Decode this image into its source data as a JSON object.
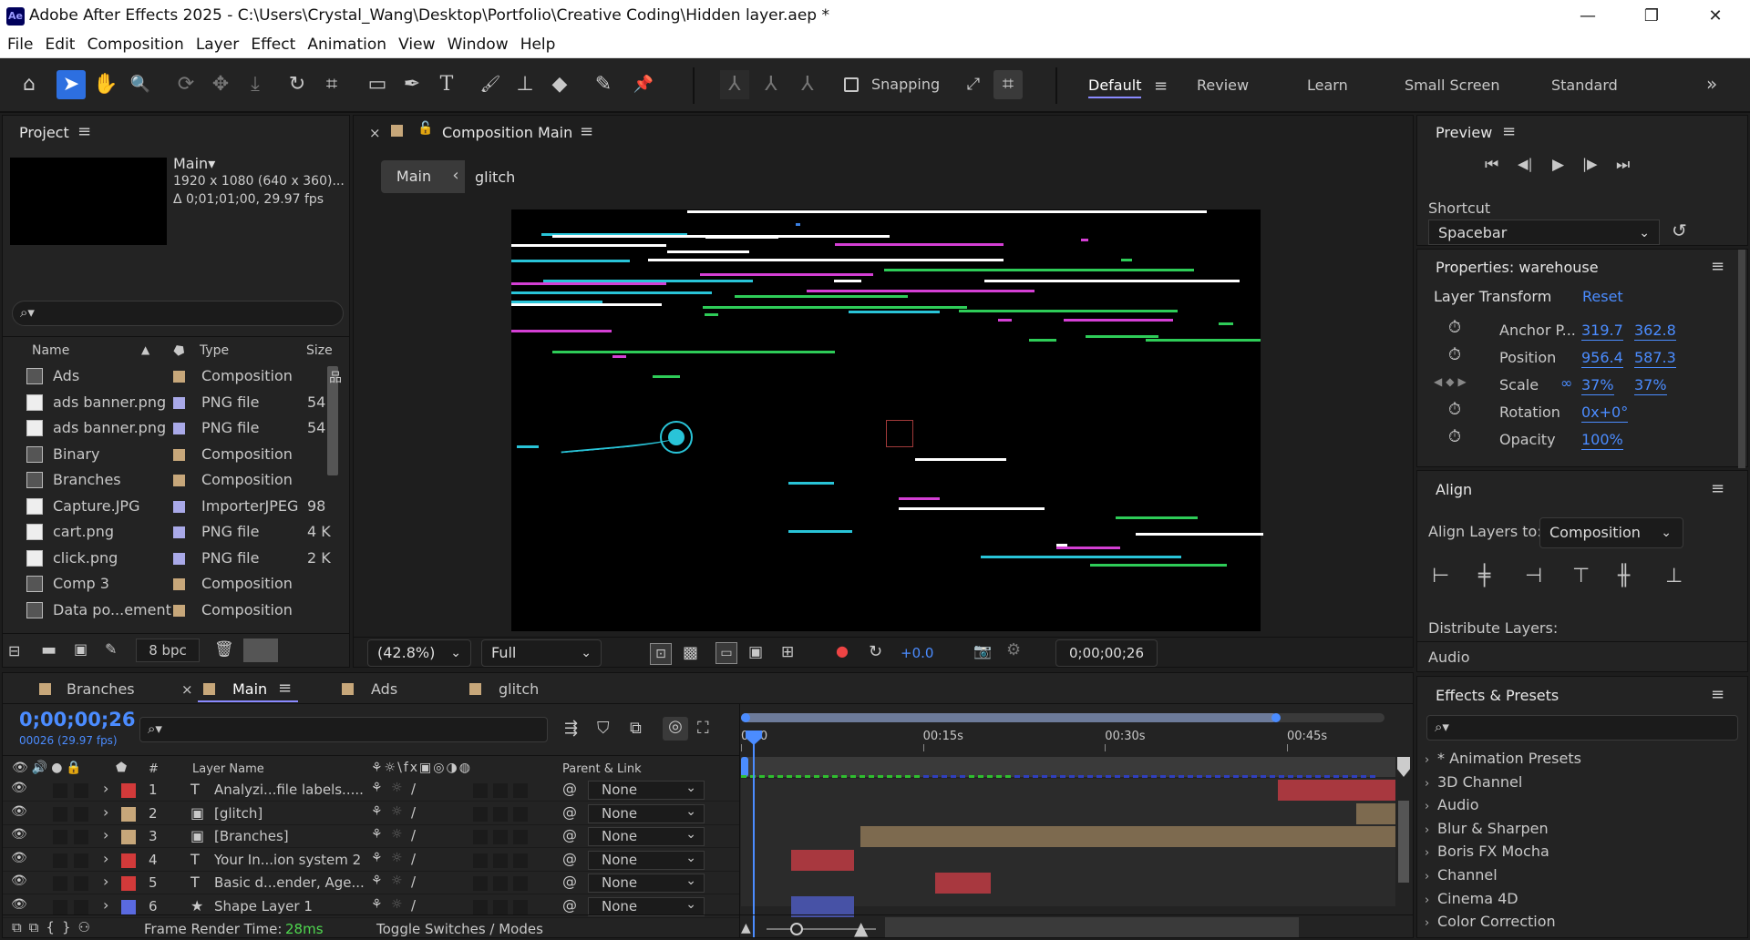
{
  "app": {
    "badge": "Ae",
    "title": "Adobe After Effects 2025 - C:\\Users\\Crystal_Wang\\Desktop\\Portfolio\\Creative Coding\\Hidden layer.aep *",
    "minimize": "—",
    "maximize": "❐",
    "close": "✕"
  },
  "menu": [
    "File",
    "Edit",
    "Composition",
    "Layer",
    "Effect",
    "Animation",
    "View",
    "Window",
    "Help"
  ],
  "toolbar": {
    "snapping_label": "Snapping",
    "workspaces": [
      "Default",
      "Review",
      "Learn",
      "Small Screen",
      "Standard"
    ],
    "more": "»",
    "tools": {
      "home": "⌂",
      "select": "➤",
      "hand": "✋",
      "zoom": "🔍",
      "orbit": "⟳",
      "pan": "✥",
      "dolly": "⤓",
      "rotate": "↻",
      "anchor": "⌗",
      "rect": "▭",
      "pen": "✒",
      "text": "T",
      "brush": "🖌",
      "stamp": "⊥",
      "eraser": "◆",
      "roto": "✎",
      "puppet": "📌",
      "axis1": "⅄",
      "axis2": "⅄",
      "axis3": "⅄",
      "snap2": "⤢",
      "snap3": "⌗"
    }
  },
  "project": {
    "title": "Project",
    "menu_glyph": "≡",
    "comp_name": "Main▾",
    "comp_res": "1920 x 1080  (640 x 360)...",
    "comp_dur": "Δ 0;01;01;00, 29.97 fps",
    "search_icon": "⌕▾",
    "columns": {
      "name": "Name",
      "sort": "▲",
      "type": "Type",
      "size": "Size"
    },
    "items": [
      {
        "name": "Ads",
        "type": "Composition",
        "size": "",
        "color": "#c7a77a",
        "icon": "comp"
      },
      {
        "name": "ads banner.png",
        "type": "PNG file",
        "size": "54",
        "color": "#a9a9e8",
        "icon": "file"
      },
      {
        "name": "ads banner.png",
        "type": "PNG file",
        "size": "54",
        "color": "#a9a9e8",
        "icon": "file"
      },
      {
        "name": "Binary",
        "type": "Composition",
        "size": "",
        "color": "#c7a77a",
        "icon": "comp"
      },
      {
        "name": "Branches",
        "type": "Composition",
        "size": "",
        "color": "#c7a77a",
        "icon": "comp"
      },
      {
        "name": "Capture.JPG",
        "type": "ImporterJPEG",
        "size": "98",
        "color": "#a9a9e8",
        "icon": "file"
      },
      {
        "name": "cart.png",
        "type": "PNG file",
        "size": "4 K",
        "color": "#a9a9e8",
        "icon": "file"
      },
      {
        "name": "click.png",
        "type": "PNG file",
        "size": "2 K",
        "color": "#a9a9e8",
        "icon": "file"
      },
      {
        "name": "Comp 3",
        "type": "Composition",
        "size": "",
        "color": "#c7a77a",
        "icon": "comp"
      },
      {
        "name": "Data po...ement",
        "type": "Composition",
        "size": "",
        "color": "#c7a77a",
        "icon": "comp"
      }
    ],
    "bpc": "8 bpc",
    "trash": "🗑"
  },
  "composition": {
    "close": "×",
    "lock": "🔓",
    "title": "Composition Main",
    "menu_glyph": "≡",
    "crumb_main": "Main",
    "crumb_arrow": "‹",
    "crumb_glitch": "glitch",
    "zoom": "(42.8%)",
    "quality": "Full",
    "exposure": "+0.0",
    "timecode": "0;00;00;26"
  },
  "preview": {
    "title": "Preview",
    "menu_glyph": "≡",
    "controls": [
      "⏮",
      "◀|",
      "▶",
      "|▶",
      "⏭"
    ],
    "shortcut_label": "Shortcut",
    "shortcut_value": "Spacebar",
    "reset_icon": "↺"
  },
  "properties": {
    "title": "Properties: warehouse",
    "menu_glyph": "≡",
    "section": "Layer Transform",
    "reset": "Reset",
    "link_icon": "∞",
    "rows": [
      {
        "label": "Anchor P...",
        "v1": "319.7",
        "v2": "362.8"
      },
      {
        "label": "Position",
        "v1": "956.4",
        "v2": "587.3"
      },
      {
        "label": "Scale",
        "v1": "37%",
        "v2": "37%"
      },
      {
        "label": "Rotation",
        "v1": "0x+0°",
        "v2": ""
      },
      {
        "label": "Opacity",
        "v1": "100%",
        "v2": ""
      }
    ]
  },
  "align": {
    "title": "Align",
    "menu_glyph": "≡",
    "align_to_label": "Align Layers to:",
    "align_to_value": "Composition",
    "distribute_label": "Distribute Layers:",
    "icons": [
      "⊢",
      "╪",
      "⊣",
      "⊤",
      "╫",
      "⊥"
    ]
  },
  "audio": {
    "title": "Audio"
  },
  "effects": {
    "title": "Effects & Presets",
    "menu_glyph": "≡",
    "search_icon": "⌕▾",
    "items": [
      "* Animation Presets",
      "3D Channel",
      "Audio",
      "Blur & Sharpen",
      "Boris FX Mocha",
      "Channel",
      "Cinema 4D",
      "Color Correction"
    ]
  },
  "timeline": {
    "tabs": [
      {
        "label": "Branches",
        "color": "#c7a77a"
      },
      {
        "label": "Main",
        "color": "#c7a77a"
      },
      {
        "label": "Ads",
        "color": "#c7a77a"
      },
      {
        "label": "glitch",
        "color": "#c7a77a"
      }
    ],
    "tab_close": "×",
    "tab_menu": "≡",
    "timecode": "0;00;00;26",
    "frames": "00026 (29.97 fps)",
    "search_icon": "⌕▾",
    "col_hash": "#",
    "col_layer_name": "Layer Name",
    "col_parent": "Parent & Link",
    "ruler": [
      "0:00",
      "00:15s",
      "00:30s",
      "00:45s"
    ],
    "layers": [
      {
        "num": "1",
        "type": "T",
        "name": "Analyzi...file labels.....",
        "color": "#d23a3a",
        "parent": "None",
        "bar_color": "#a8383f",
        "start": 0.82,
        "end": 1.0
      },
      {
        "num": "2",
        "type": "▣",
        "name": "[glitch]",
        "color": "#c7a77a",
        "parent": "None",
        "bar_color": "#7d6a4f",
        "start": 0.94,
        "end": 1.0
      },
      {
        "num": "3",
        "type": "▣",
        "name": "[Branches]",
        "color": "#c7a77a",
        "parent": "None",
        "bar_color": "#7d6a4f",
        "start": 0.183,
        "end": 1.0
      },
      {
        "num": "4",
        "type": "T",
        "name": "Your In...ion system 2",
        "color": "#d23a3a",
        "parent": "None",
        "bar_color": "#a8383f",
        "start": 0.076,
        "end": 0.173
      },
      {
        "num": "5",
        "type": "T",
        "name": "Basic d...ender, Age...",
        "color": "#d23a3a",
        "parent": "None",
        "bar_color": "#a8383f",
        "start": 0.296,
        "end": 0.382
      },
      {
        "num": "6",
        "type": "★",
        "name": "Shape Layer 1",
        "color": "#5a6ae0",
        "parent": "None",
        "bar_color": "#4752a6",
        "start": 0.076,
        "end": 0.173
      }
    ],
    "frame_render_label": "Frame Render Time:",
    "frame_render_value": "28ms",
    "toggle_label": "Toggle Switches / Modes"
  }
}
